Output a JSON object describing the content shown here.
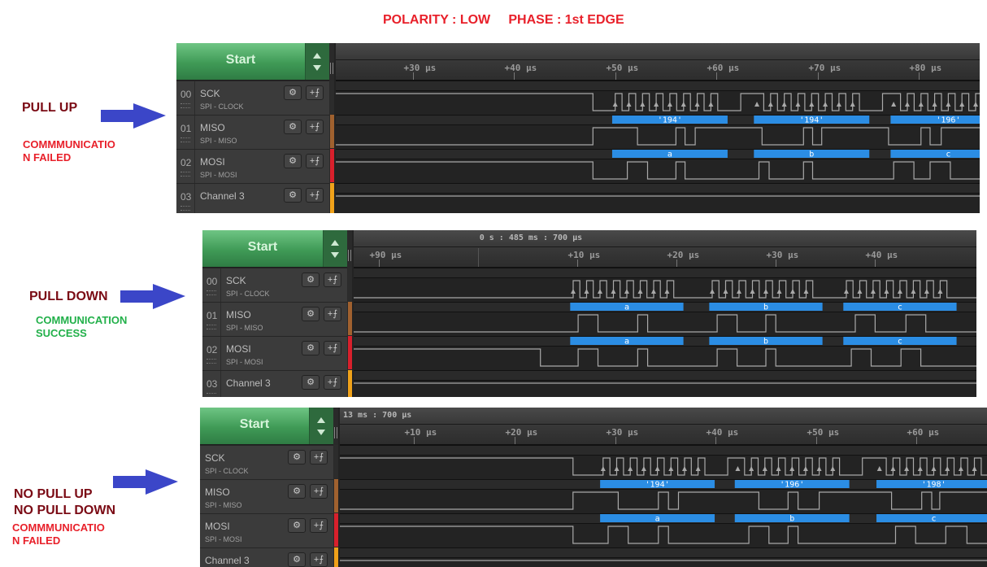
{
  "title": "POLARITY : LOW     PHASE : 1st EDGE",
  "colors": {
    "accent_blue": "#2b8de4",
    "arrow": "#3b46c8",
    "fail": "#e8202a",
    "success": "#22b04a",
    "mode_label": "#7a0a14",
    "trace": "#a9a9a9"
  },
  "scenarios": [
    {
      "mode_label": [
        "PULL UP"
      ],
      "status_label": [
        "COMMMUNICATIO",
        "N FAILED"
      ],
      "status": "fail",
      "start_label": "Start",
      "absolute_time": "",
      "show_index": true,
      "channels": [
        {
          "index": "00",
          "name": "SCK",
          "sub": "SPI - CLOCK",
          "color": "#2c2c2c"
        },
        {
          "index": "01",
          "name": "MISO",
          "sub": "SPI - MISO",
          "color": "#a0612f"
        },
        {
          "index": "02",
          "name": "MOSI",
          "sub": "SPI - MOSI",
          "color": "#d8202c"
        },
        {
          "index": "03",
          "name": "Channel 3",
          "sub": "",
          "color": "#f0a21a"
        }
      ],
      "ticks": {
        "first_us": 30,
        "step_us": 10,
        "labels": [
          "+30 µs",
          "+40 µs",
          "+50 µs",
          "+60 µs",
          "+70 µs",
          "+80 µs"
        ]
      },
      "view_us": [
        22.4,
        86
      ],
      "idle": {
        "sck": "high",
        "miso": "low",
        "mosi": "high",
        "ch3": "high"
      },
      "frames": [
        {
          "start_us": 50.0,
          "miso_decoded": "'194'",
          "mosi_decoded": "a"
        },
        {
          "start_us": 64.0,
          "miso_decoded": "'194'",
          "mosi_decoded": "b"
        },
        {
          "start_us": 77.5,
          "miso_decoded": "'196'",
          "mosi_decoded": "c"
        }
      ],
      "sck_fall_before_us": 2.2,
      "miso_transitions_us": [
        [
          47.8,
          1
        ],
        [
          52.2,
          0
        ],
        [
          56.0,
          1
        ],
        [
          56.9,
          0
        ],
        [
          57.9,
          1
        ],
        [
          64.5,
          0
        ],
        [
          68.6,
          1
        ],
        [
          69.5,
          0
        ],
        [
          70.4,
          1
        ],
        [
          77.0,
          0
        ],
        [
          80.2,
          1
        ],
        [
          81.1,
          0
        ],
        [
          82.2,
          1
        ]
      ],
      "mosi_transitions_us": [
        [
          47.8,
          0
        ],
        [
          51.2,
          1
        ],
        [
          53.2,
          0
        ],
        [
          56.0,
          1
        ],
        [
          56.9,
          0
        ],
        [
          64.2,
          1
        ],
        [
          65.2,
          0
        ],
        [
          68.6,
          1
        ],
        [
          69.5,
          0
        ],
        [
          77.5,
          1
        ],
        [
          79.5,
          0
        ],
        [
          81.1,
          1
        ],
        [
          83.1,
          0
        ]
      ]
    },
    {
      "mode_label": [
        "PULL DOWN"
      ],
      "status_label": [
        "COMMUNICATION",
        "SUCCESS"
      ],
      "status": "ok",
      "start_label": "Start",
      "absolute_time": "0 s : 485 ms : 700 µs",
      "show_index": true,
      "channels": [
        {
          "index": "00",
          "name": "SCK",
          "sub": "SPI - CLOCK",
          "color": "#2c2c2c"
        },
        {
          "index": "01",
          "name": "MISO",
          "sub": "SPI - MISO",
          "color": "#a0612f"
        },
        {
          "index": "02",
          "name": "MOSI",
          "sub": "SPI - MOSI",
          "color": "#d8202c"
        },
        {
          "index": "03",
          "name": "Channel 3",
          "sub": "",
          "color": "#f0a21a"
        }
      ],
      "ticks": {
        "first_us": -10,
        "step_us": 10,
        "labels": [
          "+90 µs",
          "",
          "+10 µs",
          "+20 µs",
          "+30 µs",
          "+40 µs"
        ]
      },
      "view_us": [
        -12.5,
        50.2
      ],
      "idle": {
        "sck": "low",
        "miso": "low",
        "mosi": "high",
        "ch3": "high"
      },
      "frames": [
        {
          "start_us": 9.6,
          "miso_decoded": "a",
          "mosi_decoded": "a"
        },
        {
          "start_us": 23.6,
          "miso_decoded": "b",
          "mosi_decoded": "b"
        },
        {
          "start_us": 37.1,
          "miso_decoded": "c",
          "mosi_decoded": "c"
        }
      ],
      "sck_fall_before_us": 0,
      "miso_transitions_us": [
        [
          10.1,
          1
        ],
        [
          12.1,
          0
        ],
        [
          16.1,
          1
        ],
        [
          17.1,
          0
        ],
        [
          24.1,
          1
        ],
        [
          26.1,
          0
        ],
        [
          29.0,
          1
        ],
        [
          30.0,
          0
        ],
        [
          38.0,
          1
        ],
        [
          40.0,
          0
        ],
        [
          43.1,
          1
        ],
        [
          45.1,
          0
        ]
      ],
      "mosi_transitions_us": [
        [
          6.3,
          0
        ],
        [
          10.1,
          1
        ],
        [
          12.1,
          0
        ],
        [
          16.1,
          1
        ],
        [
          17.1,
          0
        ],
        [
          24.1,
          1
        ],
        [
          26.1,
          0
        ],
        [
          29.0,
          1
        ],
        [
          30.0,
          0
        ],
        [
          37.6,
          1
        ],
        [
          39.6,
          0
        ],
        [
          42.6,
          1
        ],
        [
          44.6,
          0
        ]
      ]
    },
    {
      "mode_label": [
        "NO PULL UP",
        "NO PULL DOWN"
      ],
      "status_label": [
        "COMMMUNICATIO",
        "N FAILED"
      ],
      "status": "fail",
      "start_label": "Start",
      "absolute_time": "13 ms : 700 µs",
      "show_index": false,
      "channels": [
        {
          "index": "",
          "name": "SCK",
          "sub": "SPI - CLOCK",
          "color": "#2c2c2c"
        },
        {
          "index": "",
          "name": "MISO",
          "sub": "SPI - MISO",
          "color": "#a0612f"
        },
        {
          "index": "",
          "name": "MOSI",
          "sub": "SPI - MOSI",
          "color": "#d8202c"
        },
        {
          "index": "",
          "name": "Channel 3",
          "sub": "",
          "color": "#f0a21a"
        }
      ],
      "ticks": {
        "first_us": 10,
        "step_us": 10,
        "labels": [
          "+10 µs",
          "+20 µs",
          "+30 µs",
          "+40 µs",
          "+50 µs",
          "+60 µs"
        ]
      },
      "view_us": [
        2.6,
        67
      ],
      "idle": {
        "sck": "high",
        "miso": "low",
        "mosi": "high",
        "ch3": "high"
      },
      "frames": [
        {
          "start_us": 28.8,
          "miso_decoded": "'194'",
          "mosi_decoded": "a"
        },
        {
          "start_us": 42.2,
          "miso_decoded": "'196'",
          "mosi_decoded": "b"
        },
        {
          "start_us": 56.3,
          "miso_decoded": "'198'",
          "mosi_decoded": "c"
        }
      ],
      "sck_fall_before_us": 3,
      "miso_transitions_us": [
        [
          25.8,
          1
        ],
        [
          30.3,
          0
        ],
        [
          34.3,
          1
        ],
        [
          35.3,
          0
        ],
        [
          36.3,
          1
        ],
        [
          44.3,
          0
        ],
        [
          47.2,
          1
        ],
        [
          48.2,
          0
        ],
        [
          50.3,
          1
        ],
        [
          57.5,
          0
        ],
        [
          60.5,
          1
        ],
        [
          61.5,
          0
        ],
        [
          62.3,
          1
        ]
      ],
      "mosi_transitions_us": [
        [
          25.8,
          0
        ],
        [
          29.3,
          1
        ],
        [
          31.3,
          0
        ],
        [
          34.3,
          1
        ],
        [
          35.3,
          0
        ],
        [
          43.3,
          1
        ],
        [
          45.3,
          0
        ],
        [
          47.2,
          1
        ],
        [
          48.2,
          0
        ],
        [
          57.9,
          1
        ],
        [
          59.9,
          0
        ],
        [
          62.9,
          1
        ],
        [
          65.0,
          0
        ]
      ]
    }
  ]
}
